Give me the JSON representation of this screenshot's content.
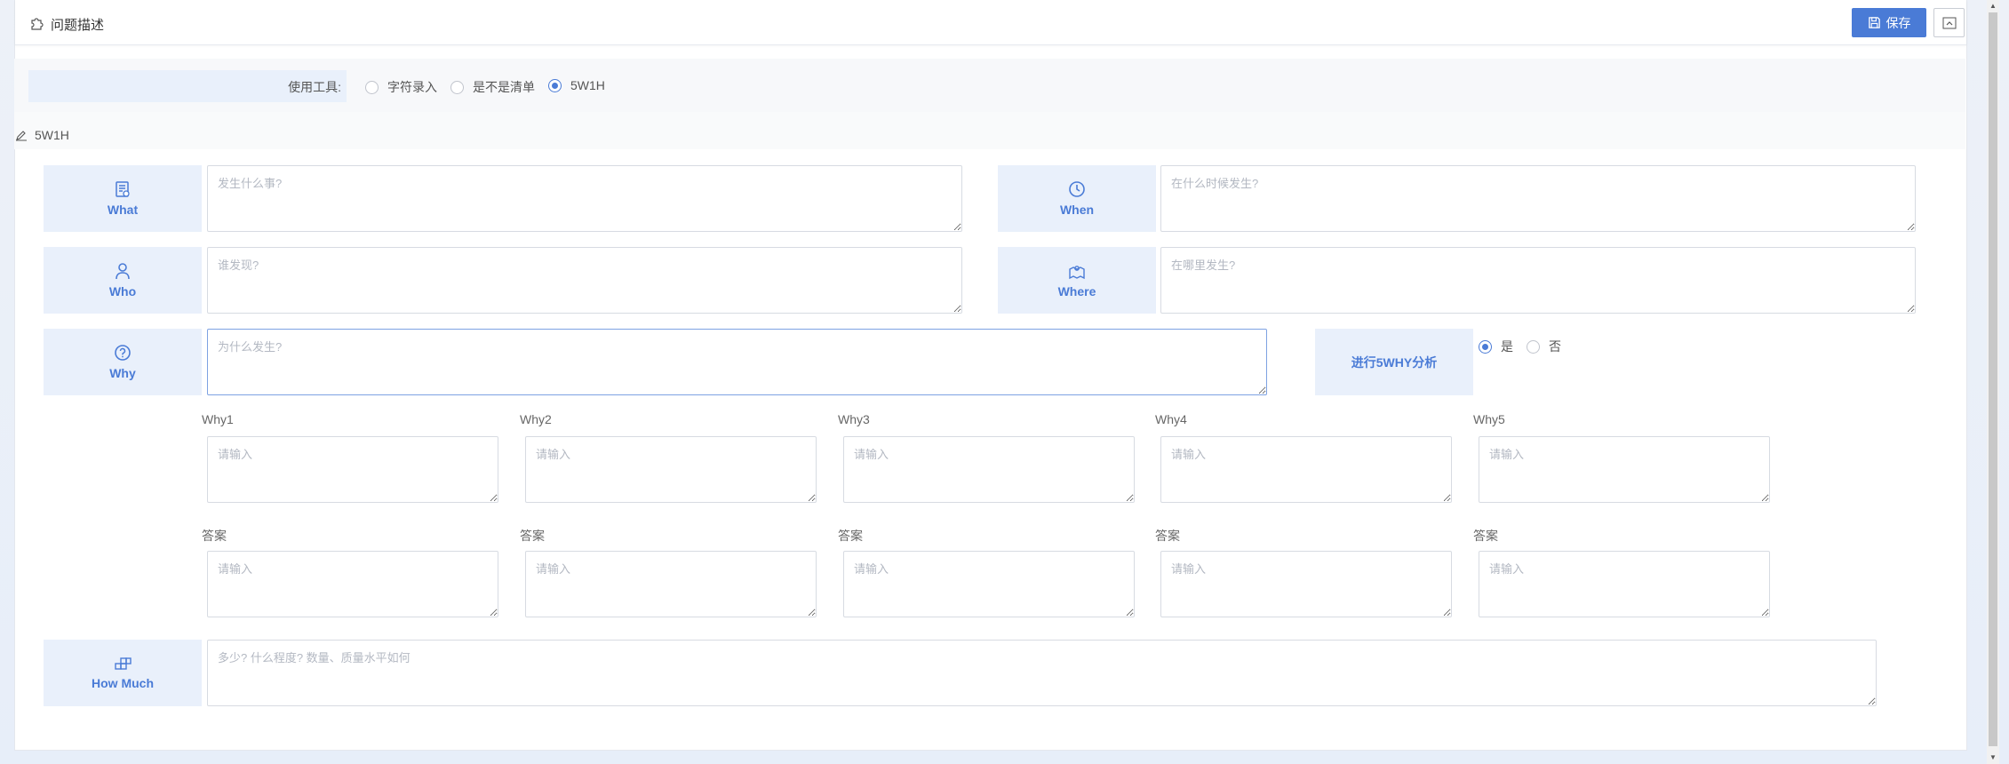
{
  "header": {
    "title": "问题描述",
    "save_label": "保存"
  },
  "tool": {
    "label": "使用工具:",
    "options": [
      {
        "label": "字符录入",
        "checked": false
      },
      {
        "label": "是不是清单",
        "checked": false
      },
      {
        "label": "5W1H",
        "checked": true
      }
    ]
  },
  "section": {
    "title": "5W1H"
  },
  "fields": {
    "what": {
      "label": "What",
      "placeholder": "发生什么事?"
    },
    "when": {
      "label": "When",
      "placeholder": "在什么时候发生?"
    },
    "who": {
      "label": "Who",
      "placeholder": "谁发现?"
    },
    "where": {
      "label": "Where",
      "placeholder": "在哪里发生?"
    },
    "why": {
      "label": "Why",
      "placeholder": "为什么发生?"
    },
    "howmuch": {
      "label": "How Much",
      "placeholder": "多少? 什么程度? 数量、质量水平如何"
    }
  },
  "five_why": {
    "label": "进行5WHY分析",
    "options": [
      {
        "label": "是",
        "checked": true
      },
      {
        "label": "否",
        "checked": false
      }
    ],
    "why_labels": [
      "Why1",
      "Why2",
      "Why3",
      "Why4",
      "Why5"
    ],
    "answer_label": "答案",
    "input_placeholder": "请输入"
  },
  "colors": {
    "accent": "#4a7bd6",
    "label_bg": "#e9f0fb"
  }
}
